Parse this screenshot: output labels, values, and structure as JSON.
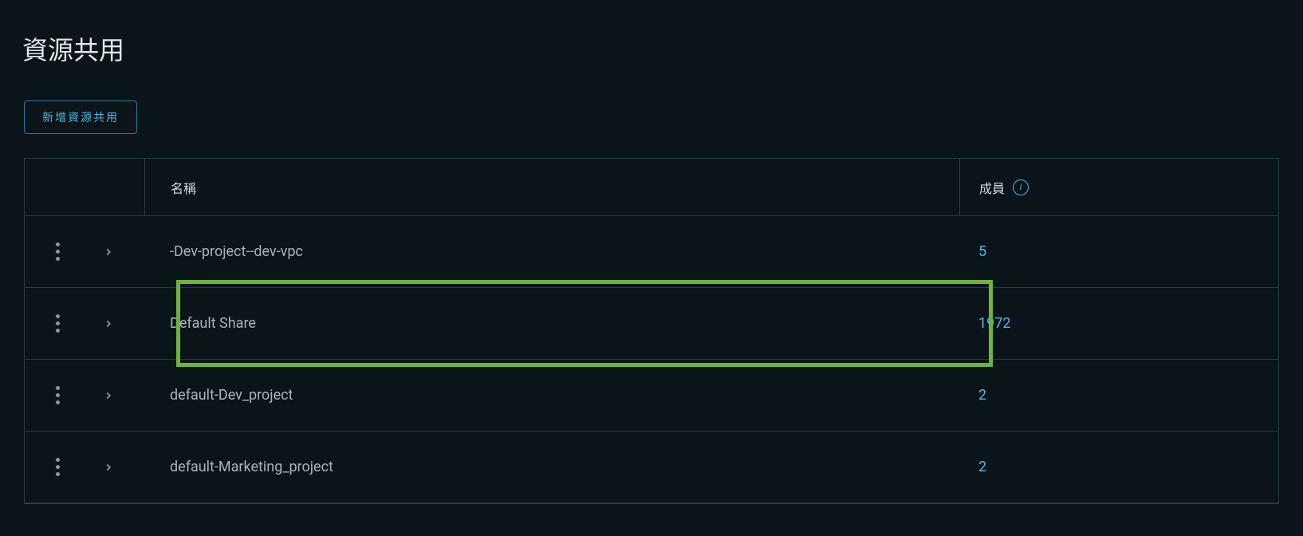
{
  "page_title": "資源共用",
  "add_button_label": "新增資源共用",
  "table": {
    "headers": {
      "name": "名稱",
      "members": "成員"
    },
    "rows": [
      {
        "name": "-Dev-project--dev-vpc",
        "members": "5",
        "highlighted": false
      },
      {
        "name": "Default Share",
        "members": "1972",
        "highlighted": true
      },
      {
        "name": "default-Dev_project",
        "members": "2",
        "highlighted": false
      },
      {
        "name": "default-Marketing_project",
        "members": "2",
        "highlighted": false
      }
    ]
  }
}
